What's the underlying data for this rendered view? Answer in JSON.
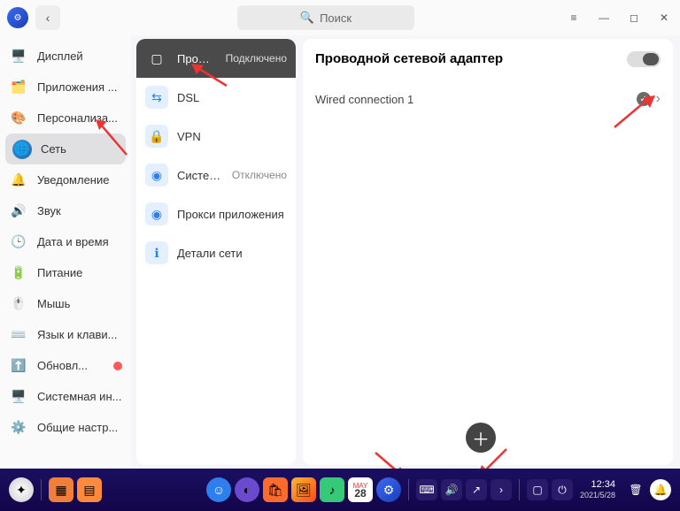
{
  "titlebar": {
    "search_placeholder": "Поиск"
  },
  "sidebar": {
    "items": [
      {
        "icon": "🖥️",
        "label": "Дисплей"
      },
      {
        "icon": "🗂️",
        "label": "Приложения ..."
      },
      {
        "icon": "🎨",
        "label": "Персонализа..."
      },
      {
        "icon": "🌐",
        "label": "Сеть",
        "active": true
      },
      {
        "icon": "🔔",
        "label": "Уведомление"
      },
      {
        "icon": "🔊",
        "label": "Звук"
      },
      {
        "icon": "🕒",
        "label": "Дата и время"
      },
      {
        "icon": "🔋",
        "label": "Питание"
      },
      {
        "icon": "🖱️",
        "label": "Мышь"
      },
      {
        "icon": "⌨️",
        "label": "Язык и клави..."
      },
      {
        "icon": "⬆️",
        "label": "Обновл...",
        "badge": true
      },
      {
        "icon": "🖥️",
        "label": "Системная ин..."
      },
      {
        "icon": "⚙️",
        "label": "Общие настр..."
      }
    ]
  },
  "midlist": {
    "items": [
      {
        "icon": "▢",
        "label": "Про…",
        "status": "Подключено",
        "active": true,
        "name": "wired"
      },
      {
        "icon": "⇆",
        "label": "DSL",
        "name": "dsl"
      },
      {
        "icon": "🔒",
        "label": "VPN",
        "name": "vpn"
      },
      {
        "icon": "◉",
        "label": "Систе…",
        "status": "Отключено",
        "name": "sysproxy"
      },
      {
        "icon": "◉",
        "label": "Прокси приложения",
        "name": "appproxy",
        "wide": true
      },
      {
        "icon": "ℹ",
        "label": "Детали сети",
        "name": "netdetails",
        "wide": true
      }
    ]
  },
  "detail": {
    "title": "Проводной сетевой адаптер",
    "connection": "Wired connection 1"
  },
  "taskbar": {
    "time": "12:34",
    "date": "2021/5/28",
    "cal_day": "28"
  }
}
